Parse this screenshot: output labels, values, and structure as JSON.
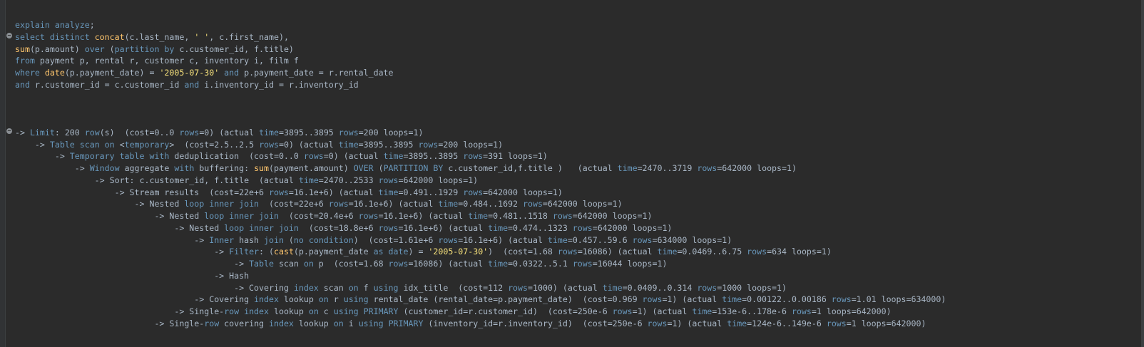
{
  "editor": {
    "fold_marker": "−",
    "lines": [
      [
        [
          "kw",
          "explain analyze"
        ],
        [
          "tx",
          ";"
        ]
      ],
      [
        [
          "kw",
          "select distinct "
        ],
        [
          "fn",
          "concat"
        ],
        [
          "tx",
          "(c.last_name, "
        ],
        [
          "str",
          "' '"
        ],
        [
          "tx",
          ", c.first_name),"
        ]
      ],
      [
        [
          "fn",
          "sum"
        ],
        [
          "tx",
          "(p.amount) "
        ],
        [
          "kw",
          "over"
        ],
        [
          "tx",
          " ("
        ],
        [
          "kw",
          "partition by"
        ],
        [
          "tx",
          " c.customer_id, f.title)"
        ]
      ],
      [
        [
          "kw",
          "from"
        ],
        [
          "tx",
          " payment p, rental r, customer c, inventory i, film f"
        ]
      ],
      [
        [
          "kw",
          "where "
        ],
        [
          "fn",
          "date"
        ],
        [
          "tx",
          "(p.payment_date) = "
        ],
        [
          "str",
          "'2005-07-30'"
        ],
        [
          "kw",
          " and"
        ],
        [
          "tx",
          " p.payment_date = r.rental_date"
        ]
      ],
      [
        [
          "kw",
          "and"
        ],
        [
          "tx",
          " r.customer_id = c.customer_id "
        ],
        [
          "kw",
          "and"
        ],
        [
          "tx",
          " i.inventory_id = r.inventory_id"
        ]
      ],
      [],
      [],
      [],
      [
        [
          "tx",
          "-> "
        ],
        [
          "kw",
          "Limit"
        ],
        [
          "tx",
          ": 200 "
        ],
        [
          "kw",
          "row"
        ],
        [
          "tx",
          "(s)  (cost=0..0 "
        ],
        [
          "kw",
          "rows"
        ],
        [
          "tx",
          "=0) (actual "
        ],
        [
          "kw",
          "time"
        ],
        [
          "tx",
          "=3895..3895 "
        ],
        [
          "kw",
          "rows"
        ],
        [
          "tx",
          "=200 loops=1)"
        ]
      ],
      [
        [
          "tx",
          "    -> "
        ],
        [
          "kw",
          "Table scan on"
        ],
        [
          "tx",
          " <"
        ],
        [
          "kw",
          "temporary"
        ],
        [
          "tx",
          ">  (cost=2.5..2.5 "
        ],
        [
          "kw",
          "rows"
        ],
        [
          "tx",
          "=0) (actual "
        ],
        [
          "kw",
          "time"
        ],
        [
          "tx",
          "=3895..3895 "
        ],
        [
          "kw",
          "rows"
        ],
        [
          "tx",
          "=200 loops=1)"
        ]
      ],
      [
        [
          "tx",
          "        -> "
        ],
        [
          "kw",
          "Temporary table with"
        ],
        [
          "tx",
          " deduplication  (cost=0..0 "
        ],
        [
          "kw",
          "rows"
        ],
        [
          "tx",
          "=0) (actual "
        ],
        [
          "kw",
          "time"
        ],
        [
          "tx",
          "=3895..3895 "
        ],
        [
          "kw",
          "rows"
        ],
        [
          "tx",
          "=391 loops=1)"
        ]
      ],
      [
        [
          "tx",
          "            -> "
        ],
        [
          "kw",
          "Window"
        ],
        [
          "tx",
          " aggregate "
        ],
        [
          "kw",
          "with"
        ],
        [
          "tx",
          " buffering: "
        ],
        [
          "fn",
          "sum"
        ],
        [
          "tx",
          "(payment.amount) "
        ],
        [
          "kw",
          "OVER"
        ],
        [
          "tx",
          " ("
        ],
        [
          "kw",
          "PARTITION BY"
        ],
        [
          "tx",
          " c.customer_id,f.title )   (actual "
        ],
        [
          "kw",
          "time"
        ],
        [
          "tx",
          "=2470..3719 "
        ],
        [
          "kw",
          "rows"
        ],
        [
          "tx",
          "=642000 loops=1)"
        ]
      ],
      [
        [
          "tx",
          "                -> Sort: c.customer_id, f.title  (actual "
        ],
        [
          "kw",
          "time"
        ],
        [
          "tx",
          "=2470..2533 "
        ],
        [
          "kw",
          "rows"
        ],
        [
          "tx",
          "=642000 loops=1)"
        ]
      ],
      [
        [
          "tx",
          "                    -> Stream results  (cost=22e+6 "
        ],
        [
          "kw",
          "rows"
        ],
        [
          "tx",
          "=16.1e+6) (actual "
        ],
        [
          "kw",
          "time"
        ],
        [
          "tx",
          "=0.491..1929 "
        ],
        [
          "kw",
          "rows"
        ],
        [
          "tx",
          "=642000 loops=1)"
        ]
      ],
      [
        [
          "tx",
          "                        -> Nested "
        ],
        [
          "kw",
          "loop inner join"
        ],
        [
          "tx",
          "  (cost=22e+6 "
        ],
        [
          "kw",
          "rows"
        ],
        [
          "tx",
          "=16.1e+6) (actual "
        ],
        [
          "kw",
          "time"
        ],
        [
          "tx",
          "=0.484..1692 "
        ],
        [
          "kw",
          "rows"
        ],
        [
          "tx",
          "=642000 loops=1)"
        ]
      ],
      [
        [
          "tx",
          "                            -> Nested "
        ],
        [
          "kw",
          "loop inner join"
        ],
        [
          "tx",
          "  (cost=20.4e+6 "
        ],
        [
          "kw",
          "rows"
        ],
        [
          "tx",
          "=16.1e+6) (actual "
        ],
        [
          "kw",
          "time"
        ],
        [
          "tx",
          "=0.481..1518 "
        ],
        [
          "kw",
          "rows"
        ],
        [
          "tx",
          "=642000 loops=1)"
        ]
      ],
      [
        [
          "tx",
          "                                -> Nested "
        ],
        [
          "kw",
          "loop inner join"
        ],
        [
          "tx",
          "  (cost=18.8e+6 "
        ],
        [
          "kw",
          "rows"
        ],
        [
          "tx",
          "=16.1e+6) (actual "
        ],
        [
          "kw",
          "time"
        ],
        [
          "tx",
          "=0.474..1323 "
        ],
        [
          "kw",
          "rows"
        ],
        [
          "tx",
          "=642000 loops=1)"
        ]
      ],
      [
        [
          "tx",
          "                                    -> "
        ],
        [
          "kw",
          "Inner"
        ],
        [
          "tx",
          " hash "
        ],
        [
          "kw",
          "join"
        ],
        [
          "tx",
          " ("
        ],
        [
          "kw",
          "no condition"
        ],
        [
          "tx",
          ")  (cost=1.61e+6 "
        ],
        [
          "kw",
          "rows"
        ],
        [
          "tx",
          "=16.1e+6) (actual "
        ],
        [
          "kw",
          "time"
        ],
        [
          "tx",
          "=0.457..59.6 "
        ],
        [
          "kw",
          "rows"
        ],
        [
          "tx",
          "=634000 loops=1)"
        ]
      ],
      [
        [
          "tx",
          "                                        -> "
        ],
        [
          "kw",
          "Filter"
        ],
        [
          "tx",
          ": ("
        ],
        [
          "fn",
          "cast"
        ],
        [
          "tx",
          "(p.payment_date "
        ],
        [
          "kw",
          "as date"
        ],
        [
          "tx",
          ") = "
        ],
        [
          "str",
          "'2005-07-30'"
        ],
        [
          "tx",
          ")  (cost=1.68 "
        ],
        [
          "kw",
          "rows"
        ],
        [
          "tx",
          "=16086) (actual "
        ],
        [
          "kw",
          "time"
        ],
        [
          "tx",
          "=0.0469..6.75 "
        ],
        [
          "kw",
          "rows"
        ],
        [
          "tx",
          "=634 loops=1)"
        ]
      ],
      [
        [
          "tx",
          "                                            -> "
        ],
        [
          "kw",
          "Table"
        ],
        [
          "tx",
          " scan "
        ],
        [
          "kw",
          "on"
        ],
        [
          "tx",
          " p  (cost=1.68 "
        ],
        [
          "kw",
          "rows"
        ],
        [
          "tx",
          "=16086) (actual "
        ],
        [
          "kw",
          "time"
        ],
        [
          "tx",
          "=0.0322..5.1 "
        ],
        [
          "kw",
          "rows"
        ],
        [
          "tx",
          "=16044 loops=1)"
        ]
      ],
      [
        [
          "tx",
          "                                        -> Hash"
        ]
      ],
      [
        [
          "tx",
          "                                            -> Covering "
        ],
        [
          "kw",
          "index"
        ],
        [
          "tx",
          " scan "
        ],
        [
          "kw",
          "on"
        ],
        [
          "tx",
          " f "
        ],
        [
          "kw",
          "using"
        ],
        [
          "tx",
          " idx_title  (cost=112 "
        ],
        [
          "kw",
          "rows"
        ],
        [
          "tx",
          "=1000) (actual "
        ],
        [
          "kw",
          "time"
        ],
        [
          "tx",
          "=0.0409..0.314 "
        ],
        [
          "kw",
          "rows"
        ],
        [
          "tx",
          "=1000 loops=1)"
        ]
      ],
      [
        [
          "tx",
          "                                    -> Covering "
        ],
        [
          "kw",
          "index"
        ],
        [
          "tx",
          " lookup "
        ],
        [
          "kw",
          "on"
        ],
        [
          "tx",
          " r "
        ],
        [
          "kw",
          "using"
        ],
        [
          "tx",
          " rental_date (rental_date=p.payment_date)  (cost=0.969 "
        ],
        [
          "kw",
          "rows"
        ],
        [
          "tx",
          "=1) (actual "
        ],
        [
          "kw",
          "time"
        ],
        [
          "tx",
          "=0.00122..0.00186 "
        ],
        [
          "kw",
          "rows"
        ],
        [
          "tx",
          "=1.01 loops=634000)"
        ]
      ],
      [
        [
          "tx",
          "                                -> Single-"
        ],
        [
          "kw",
          "row index"
        ],
        [
          "tx",
          " lookup "
        ],
        [
          "kw",
          "on"
        ],
        [
          "tx",
          " c "
        ],
        [
          "kw",
          "using PRIMARY"
        ],
        [
          "tx",
          " (customer_id=r.customer_id)  (cost=250e-6 "
        ],
        [
          "kw",
          "rows"
        ],
        [
          "tx",
          "=1) (actual "
        ],
        [
          "kw",
          "time"
        ],
        [
          "tx",
          "=153e-6..178e-6 "
        ],
        [
          "kw",
          "rows"
        ],
        [
          "tx",
          "=1 loops=642000)"
        ]
      ],
      [
        [
          "tx",
          "                            -> Single-"
        ],
        [
          "kw",
          "row"
        ],
        [
          "tx",
          " covering "
        ],
        [
          "kw",
          "index"
        ],
        [
          "tx",
          " lookup "
        ],
        [
          "kw",
          "on"
        ],
        [
          "tx",
          " i "
        ],
        [
          "kw",
          "using PRIMARY"
        ],
        [
          "tx",
          " (inventory_id=r.inventory_id)  (cost=250e-6 "
        ],
        [
          "kw",
          "rows"
        ],
        [
          "tx",
          "=1) (actual "
        ],
        [
          "kw",
          "time"
        ],
        [
          "tx",
          "=124e-6..149e-6 "
        ],
        [
          "kw",
          "rows"
        ],
        [
          "tx",
          "=1 loops=642000)"
        ]
      ]
    ]
  }
}
